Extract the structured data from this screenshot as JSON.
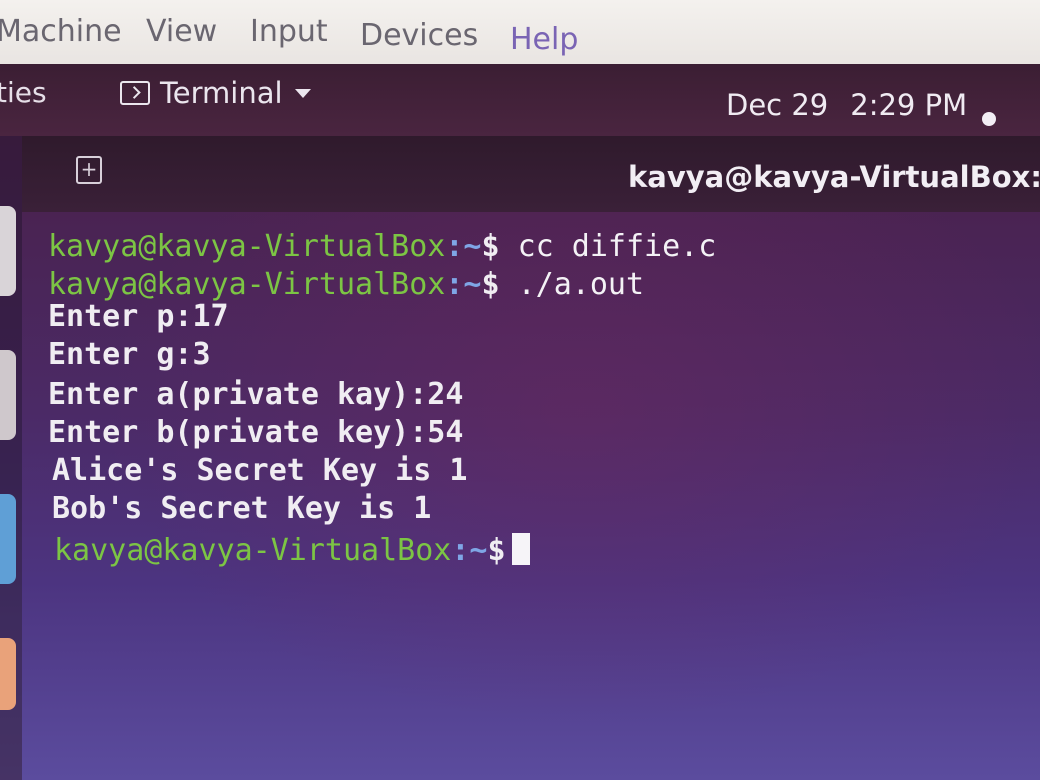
{
  "vbox_menu": {
    "items": [
      "Machine",
      "View",
      "Input",
      "Devices",
      "Help"
    ],
    "help_color": "#7a64b4"
  },
  "panel": {
    "activities": "ties",
    "app_menu": "Terminal",
    "date": "Dec 29",
    "time": "2:29 PM"
  },
  "terminal": {
    "title": "kavya@kavya-VirtualBox: ~",
    "prompt_user": "kavya@kavya-VirtualBox",
    "prompt_path": ":~",
    "prompt_dollar": "$",
    "commands": [
      "cc diffie.c",
      "./a.out"
    ],
    "output": [
      "Enter p:17",
      "Enter g:3",
      "Enter a(private kay):24",
      "Enter b(private key):54",
      "Alice's Secret Key is 1",
      "Bob's Secret Key is 1"
    ]
  },
  "colors": {
    "prompt_green": "#7cc544",
    "prompt_blue": "#7fa6e6",
    "terminal_bg": "#4b2a66",
    "menubar_bg": "#f0ede9"
  },
  "icons": {
    "new_tab": "new-tab-icon",
    "terminal": "terminal-icon",
    "dropdown": "chevron-down-icon",
    "status": "status-dot-icon"
  }
}
